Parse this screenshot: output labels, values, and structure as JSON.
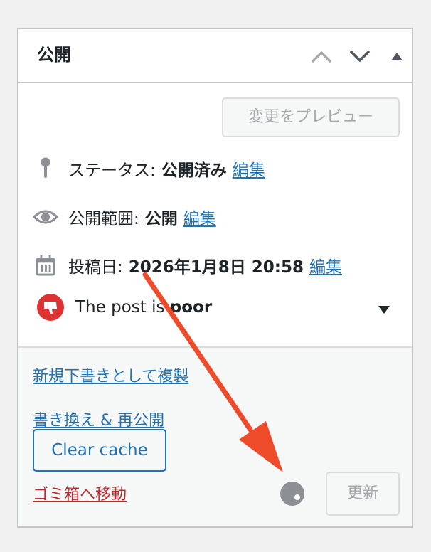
{
  "box": {
    "title": "公開"
  },
  "preview_button": "変更をプレビュー",
  "status": {
    "label": "ステータス:",
    "value": "公開済み",
    "edit": "編集"
  },
  "visibility": {
    "label": "公開範囲:",
    "value": "公開",
    "edit": "編集"
  },
  "publish_date": {
    "label": "投稿日:",
    "value": "2026年1月8日 20:58",
    "edit": "編集"
  },
  "seo": {
    "text": "The post is ",
    "rating": "poor",
    "color": "#dc3232"
  },
  "actions": {
    "duplicate_link": "新規下書きとして複製",
    "rewrite_link": "書き換え & 再公開",
    "clear_cache": "Clear cache",
    "trash_link": "ゴミ箱へ移動",
    "update_button": "更新"
  },
  "colors": {
    "link": "#2271b1",
    "trash": "#b32d2e",
    "annotation_arrow": "#ee4b2b"
  },
  "icons": [
    "chevron-up-icon",
    "chevron-down-icon",
    "collapse-triangle-icon",
    "pin-icon",
    "eye-icon",
    "calendar-icon",
    "thumbs-down-icon",
    "dropdown-triangle-icon"
  ]
}
